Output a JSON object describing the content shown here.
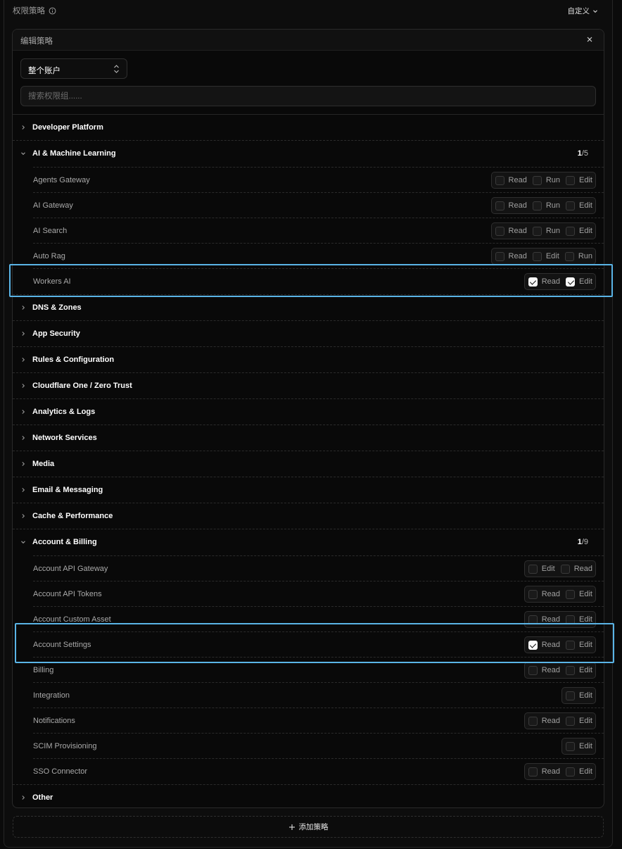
{
  "header": {
    "title": "权限策略",
    "mode_label": "自定义"
  },
  "card": {
    "title": "编辑策略"
  },
  "scope_select": {
    "value": "整个账户"
  },
  "search": {
    "placeholder": "搜索权限组......"
  },
  "groups": [
    {
      "id": "developer-platform",
      "label": "Developer Platform",
      "expanded": false
    },
    {
      "id": "ai-ml",
      "label": "AI & Machine Learning",
      "expanded": true,
      "count_selected": "1",
      "count_total": "/5",
      "items": [
        {
          "id": "agents-gateway",
          "label": "Agents Gateway",
          "options": [
            {
              "label": "Read",
              "checked": false
            },
            {
              "label": "Run",
              "checked": false
            },
            {
              "label": "Edit",
              "checked": false
            }
          ]
        },
        {
          "id": "ai-gateway",
          "label": "AI Gateway",
          "options": [
            {
              "label": "Read",
              "checked": false
            },
            {
              "label": "Run",
              "checked": false
            },
            {
              "label": "Edit",
              "checked": false
            }
          ]
        },
        {
          "id": "ai-search",
          "label": "AI Search",
          "options": [
            {
              "label": "Read",
              "checked": false
            },
            {
              "label": "Run",
              "checked": false
            },
            {
              "label": "Edit",
              "checked": false
            }
          ]
        },
        {
          "id": "auto-rag",
          "label": "Auto Rag",
          "options": [
            {
              "label": "Read",
              "checked": false
            },
            {
              "label": "Edit",
              "checked": false
            },
            {
              "label": "Run",
              "checked": false
            }
          ]
        },
        {
          "id": "workers-ai",
          "label": "Workers AI",
          "options": [
            {
              "label": "Read",
              "checked": true
            },
            {
              "label": "Edit",
              "checked": true
            }
          ]
        }
      ]
    },
    {
      "id": "dns-zones",
      "label": "DNS & Zones",
      "expanded": false
    },
    {
      "id": "app-security",
      "label": "App Security",
      "expanded": false
    },
    {
      "id": "rules-config",
      "label": "Rules & Configuration",
      "expanded": false
    },
    {
      "id": "cloudflare-one",
      "label": "Cloudflare One / Zero Trust",
      "expanded": false
    },
    {
      "id": "analytics-logs",
      "label": "Analytics & Logs",
      "expanded": false
    },
    {
      "id": "network-services",
      "label": "Network Services",
      "expanded": false
    },
    {
      "id": "media",
      "label": "Media",
      "expanded": false
    },
    {
      "id": "email-messaging",
      "label": "Email & Messaging",
      "expanded": false
    },
    {
      "id": "cache-performance",
      "label": "Cache & Performance",
      "expanded": false
    },
    {
      "id": "account-billing",
      "label": "Account & Billing",
      "expanded": true,
      "count_selected": "1",
      "count_total": "/9",
      "items": [
        {
          "id": "account-api-gateway",
          "label": "Account API Gateway",
          "options": [
            {
              "label": "Edit",
              "checked": false
            },
            {
              "label": "Read",
              "checked": false
            }
          ]
        },
        {
          "id": "account-api-tokens",
          "label": "Account API Tokens",
          "options": [
            {
              "label": "Read",
              "checked": false
            },
            {
              "label": "Edit",
              "checked": false
            }
          ]
        },
        {
          "id": "account-custom-asset",
          "label": "Account Custom Asset",
          "options": [
            {
              "label": "Read",
              "checked": false
            },
            {
              "label": "Edit",
              "checked": false
            }
          ]
        },
        {
          "id": "account-settings",
          "label": "Account Settings",
          "options": [
            {
              "label": "Read",
              "checked": true
            },
            {
              "label": "Edit",
              "checked": false
            }
          ]
        },
        {
          "id": "billing",
          "label": "Billing",
          "options": [
            {
              "label": "Read",
              "checked": false
            },
            {
              "label": "Edit",
              "checked": false
            }
          ]
        },
        {
          "id": "integration",
          "label": "Integration",
          "options": [
            {
              "label": "Edit",
              "checked": false
            }
          ]
        },
        {
          "id": "notifications",
          "label": "Notifications",
          "options": [
            {
              "label": "Read",
              "checked": false
            },
            {
              "label": "Edit",
              "checked": false
            }
          ]
        },
        {
          "id": "scim-provisioning",
          "label": "SCIM Provisioning",
          "options": [
            {
              "label": "Edit",
              "checked": false
            }
          ]
        },
        {
          "id": "sso-connector",
          "label": "SSO Connector",
          "options": [
            {
              "label": "Read",
              "checked": false
            },
            {
              "label": "Edit",
              "checked": false
            }
          ]
        }
      ]
    },
    {
      "id": "other",
      "label": "Other",
      "expanded": false
    }
  ],
  "add_policy": {
    "label": "添加策略"
  },
  "colors": {
    "highlight": "#5ab4e6",
    "checked": "#fafafa"
  }
}
